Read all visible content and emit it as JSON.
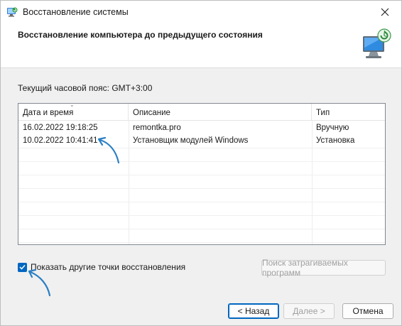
{
  "window": {
    "title": "Восстановление системы",
    "close_icon": "close-icon"
  },
  "header": {
    "title": "Восстановление компьютера до предыдущего состояния",
    "icon": "system-restore-monitor-icon"
  },
  "timezone_label": "Текущий часовой пояс: GMT+3:00",
  "table": {
    "columns": [
      "Дата и время",
      "Описание",
      "Тип"
    ],
    "rows": [
      {
        "date": "16.02.2022 19:18:25",
        "description": "remontka.pro",
        "type": "Вручную"
      },
      {
        "date": "10.02.2022 10:41:41",
        "description": "Установщик модулей Windows",
        "type": "Установка"
      }
    ]
  },
  "show_more": {
    "label": "Показать другие точки восстановления",
    "checked": true
  },
  "scan_button": "Поиск затрагиваемых программ",
  "footer": {
    "back": "< Назад",
    "next": "Далее >",
    "cancel": "Отмена"
  },
  "colors": {
    "accent": "#0067c0",
    "annotation_arrow": "#2b7fc4"
  }
}
